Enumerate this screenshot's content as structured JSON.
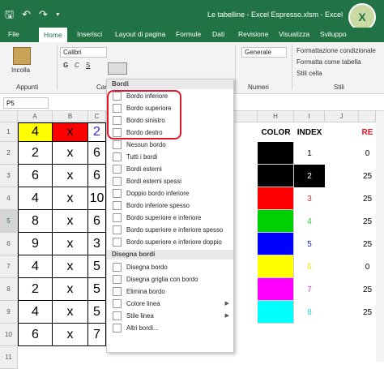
{
  "titlebar": {
    "title": "Le tabelline - Excel Espresso.xlsm - Excel",
    "logo_text": "X"
  },
  "tabs": [
    {
      "label": "File"
    },
    {
      "label": "Home"
    },
    {
      "label": "Inserisci"
    },
    {
      "label": "Layout di pagina"
    },
    {
      "label": "Formule"
    },
    {
      "label": "Dati"
    },
    {
      "label": "Revisione"
    },
    {
      "label": "Visualizza"
    },
    {
      "label": "Sviluppo"
    }
  ],
  "ribbon": {
    "paste_label": "Incolla",
    "clipboard_label": "Appunti",
    "font_name": "Calibri",
    "font_group_label": "Cara",
    "number_format": "Generale",
    "numbers_label": "Numeri",
    "cond_format": "Formattazione condizionale",
    "format_table": "Formatta come tabella",
    "cell_styles": "Stili cella",
    "styles_label": "Stili"
  },
  "formula": {
    "namebox": "P5"
  },
  "columns": [
    "A",
    "B",
    "C",
    "H",
    "I",
    "J"
  ],
  "rows": [
    "1",
    "2",
    "3",
    "4",
    "5",
    "6",
    "7",
    "8",
    "9",
    "10",
    "11"
  ],
  "grid": {
    "col_a": [
      "4",
      "2",
      "6",
      "4",
      "8",
      "9",
      "4",
      "2",
      "4",
      "6"
    ],
    "col_b": [
      "x",
      "x",
      "x",
      "x",
      "x",
      "x",
      "x",
      "x",
      "x",
      "x"
    ],
    "col_c": [
      "2",
      "6",
      "6",
      "10",
      "6",
      "3",
      "5",
      "5",
      "5",
      "7"
    ],
    "header_color": "COLOR",
    "header_index": "INDEX",
    "header_re": "RE",
    "index_values": [
      "1",
      "2",
      "3",
      "4",
      "5",
      "6",
      "7",
      "8"
    ],
    "index_colors": [
      "#000000",
      "#ffffff",
      "#d9342b",
      "#32c832",
      "#1818d8",
      "#e8e800",
      "#d838d8",
      "#28d8d8"
    ],
    "swatch_colors": [
      "#000000",
      "#000000",
      "#ff0000",
      "#00d000",
      "#0000ff",
      "#ffff00",
      "#ff00ff",
      "#00ffff"
    ],
    "right_values": [
      "0",
      "25",
      "25",
      "25",
      "25",
      "0",
      "25",
      "25"
    ],
    "a1_fill": "#ffff00",
    "b1_fill": "#ff0000"
  },
  "menu": {
    "title": "Bordi",
    "items": [
      {
        "label": "Bordo inferiore"
      },
      {
        "label": "Bordo superiore"
      },
      {
        "label": "Bordo sinistro"
      },
      {
        "label": "Bordo destro"
      },
      {
        "label": "Nessun bordo"
      },
      {
        "label": "Tutti i bordi"
      },
      {
        "label": "Bordi esterni"
      },
      {
        "label": "Bordi esterni spessi"
      },
      {
        "label": "Doppio bordo inferiore"
      },
      {
        "label": "Bordo inferiore spesso"
      },
      {
        "label": "Bordo superiore e inferiore"
      },
      {
        "label": "Bordo superiore e inferiore spesso"
      },
      {
        "label": "Bordo superiore e inferiore doppio"
      }
    ],
    "draw_title": "Disegna bordi",
    "draw_items": [
      {
        "label": "Disegna bordo"
      },
      {
        "label": "Disegna griglia con bordo"
      },
      {
        "label": "Elimina bordo"
      },
      {
        "label": "Colore linea"
      },
      {
        "label": "Stile linea"
      },
      {
        "label": "Altri bordi..."
      }
    ],
    "highlight_color": "#e0162b"
  }
}
